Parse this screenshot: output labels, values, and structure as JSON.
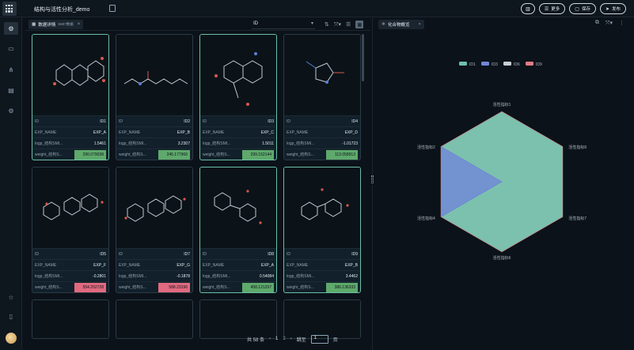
{
  "header": {
    "app_title": "结构与活性分析_demo",
    "buttons": [
      {
        "name": "layout-button",
        "label": "",
        "icon": "layout-icon"
      },
      {
        "name": "more-button",
        "label": "更多",
        "icon": "list-icon"
      },
      {
        "name": "save-button",
        "label": "保存",
        "icon": "save-icon"
      },
      {
        "name": "publish-button",
        "label": "发布",
        "icon": "send-icon"
      }
    ]
  },
  "left_panel": {
    "tab_label": "数据详情",
    "tab_sub": "SMI7数据",
    "sort_field": "ID",
    "cards": [
      {
        "id": "ID1",
        "exp_name": "EXP_A",
        "logp": "1.5461",
        "weight": "290.079038",
        "weight_color": "green"
      },
      {
        "id": "ID2",
        "exp_name": "EXP_B",
        "logp": "3.2307",
        "weight": "245.177966",
        "weight_color": "green"
      },
      {
        "id": "ID3",
        "exp_name": "EXP_C",
        "logp": "1.5011",
        "weight": "299.152144",
        "weight_color": "green"
      },
      {
        "id": "ID4",
        "exp_name": "EXP_D",
        "logp": "-1.01723",
        "weight": "113.058913",
        "weight_color": "green"
      },
      {
        "id": "ID5",
        "exp_name": "EXP_F",
        "logp": "-0.2801",
        "weight": "554.252728",
        "weight_color": "red"
      },
      {
        "id": "ID7",
        "exp_name": "EXP_G",
        "logp": "-0.1878",
        "weight": "588.23196",
        "weight_color": "red"
      },
      {
        "id": "ID8",
        "exp_name": "EXP_A",
        "logp": "0.54084",
        "weight": "458.121297",
        "weight_color": "green"
      },
      {
        "id": "ID9",
        "exp_name": "EXP_B",
        "logp": "3.4462",
        "weight": "386.136333",
        "weight_color": "green"
      }
    ],
    "row_keys": {
      "id": "ID",
      "exp_name": "EXP_NAME",
      "logp": "logp_结构SMI...",
      "weight": "weight_结构S..."
    },
    "pager": {
      "total": "共 58 条",
      "pages": [
        "1",
        "2"
      ],
      "current": "1",
      "goto_label": "跳至",
      "goto_value": "1",
      "page_unit": "页"
    }
  },
  "right_panel": {
    "tab_label": "化合物概览",
    "chart_data": {
      "type": "radar",
      "axes": [
        "活性指标1",
        "活性指标8",
        "活性指标7",
        "活性指标6",
        "活性指标4",
        "活性指标2"
      ],
      "series": [
        {
          "name": "ID1",
          "color": "#6fbfa8",
          "values": [
            1.0,
            1.0,
            1.0,
            1.0,
            1.0,
            1.0
          ]
        },
        {
          "name": "ID3",
          "color": "#6f86d8",
          "values": [
            0.0,
            0.0,
            0.0,
            0.0,
            1.0,
            1.0
          ]
        },
        {
          "name": "ID6",
          "color": "#c9ced3",
          "values": [
            1.0,
            1.0,
            1.0,
            1.0,
            1.0,
            1.0
          ]
        },
        {
          "name": "ID9",
          "color": "#e07b86",
          "values": [
            1.0,
            1.0,
            1.0,
            1.0,
            1.0,
            1.0
          ]
        }
      ],
      "legend_position": "top-center",
      "grid": true
    }
  }
}
